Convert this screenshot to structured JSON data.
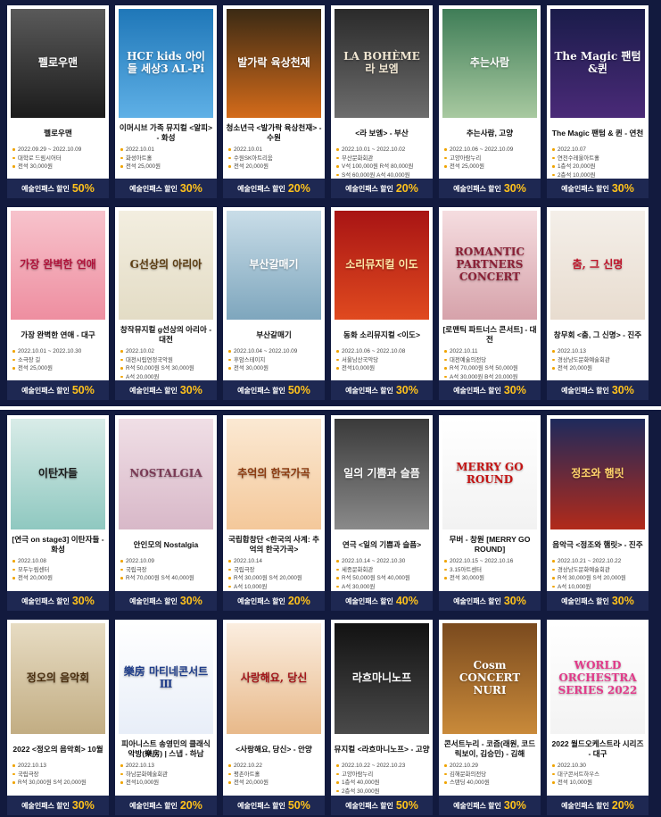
{
  "discount_label": "예술인패스 할인",
  "colors": {
    "section_bg": "#121a3e",
    "discount_bg": "#1e2852",
    "percent": "#ffc21c",
    "bullet": "#f0a400"
  },
  "section1": [
    {
      "poster_text": "펠로우맨",
      "poster_bg": "linear-gradient(180deg,#5a5a5a,#1b1b1b)",
      "poster_color": "#ffffff",
      "title": "펠로우맨",
      "info": [
        "2022.09.29 ~ 2022.10.09",
        "대학로 드림시어터",
        "전석 30,000원"
      ],
      "percent": "50%"
    },
    {
      "poster_text": "HCF kids 아이들 세상3 AL-Pi",
      "poster_bg": "linear-gradient(180deg,#1f77b8,#5fb0e6)",
      "poster_color": "#ffffff",
      "title": "이머시브 가족 뮤지컬 <알피> - 화성",
      "info": [
        "2022.10.01",
        "화성아트홀",
        "전석 25,000원"
      ],
      "percent": "30%"
    },
    {
      "poster_text": "발가락 육상천재",
      "poster_bg": "linear-gradient(180deg,#3b2a14,#d46b1a)",
      "poster_color": "#ffffff",
      "title": "청소년극 <발가락 육상천재> - 수원",
      "info": [
        "2022.10.01",
        "수원SK아트리움",
        "전석 20,000원"
      ],
      "percent": "20%"
    },
    {
      "poster_text": "LA BOHÈME 라 보엠",
      "poster_bg": "linear-gradient(180deg,#2a2a2a,#6d6d6d)",
      "poster_color": "#f0e6d2",
      "title": "<라 보엠> - 부산",
      "info": [
        "2022.10.01 ~ 2022.10.02",
        "부산문화회관",
        "V석 100,000원  R석 80,000원",
        "S석 60,000원  A석 40,000원"
      ],
      "percent": "20%"
    },
    {
      "poster_text": "추는사람",
      "poster_bg": "linear-gradient(180deg,#3f7d57,#a8c9a0)",
      "poster_color": "#ffffff",
      "title": "추는사람, 고양",
      "info": [
        "2022.10.06 ~ 2022.10.09",
        "고양아람누리",
        "전석 25,000원"
      ],
      "percent": "30%"
    },
    {
      "poster_text": "The Magic 팬텀&퀸",
      "poster_bg": "linear-gradient(180deg,#1a1c4a,#4a2a78)",
      "poster_color": "#ffffff",
      "title": "The Magic 팬텀 & 퀸 - 연천",
      "info": [
        "2022.10.07",
        "연천수레울아트홀",
        "1층석 20,000원",
        "2층석 10,000원"
      ],
      "percent": "30%"
    },
    {
      "poster_text": "가장 완벽한 연애",
      "poster_bg": "linear-gradient(180deg,#f7c3cc,#ee8ea0)",
      "poster_color": "#b0123a",
      "title": "가장 완벽한 연애 - 대구",
      "info": [
        "2022.10.01 ~ 2022.10.30",
        "소극장 길",
        "전석 25,000원"
      ],
      "percent": "50%"
    },
    {
      "poster_text": "G선상의 아리아",
      "poster_bg": "linear-gradient(180deg,#f3eee0,#e3dcc5)",
      "poster_color": "#5c3d12",
      "title": "창작뮤지컬 g선상의 아리아 - 대전",
      "info": [
        "2022.10.02",
        "대전시립연정국악원",
        "R석 50,000원  S석 30,000원",
        "A석 20,000원"
      ],
      "percent": "30%"
    },
    {
      "poster_text": "부산갈매기",
      "poster_bg": "linear-gradient(180deg,#c9dde8,#7ea6bd)",
      "poster_color": "#ffffff",
      "title": "부산갈매기",
      "info": [
        "2022.10.04 ~ 2022.10.09",
        "후암스테이지",
        "전석 30,000원"
      ],
      "percent": "50%"
    },
    {
      "poster_text": "소리뮤지컬 이도",
      "poster_bg": "linear-gradient(180deg,#a81414,#e04a1f)",
      "poster_color": "#ffe9a8",
      "title": "동화 소리뮤지컬 <이도>",
      "info": [
        "2022.10.06 ~ 2022.10.08",
        "서울남산국악당",
        "전석10,000원"
      ],
      "percent": "30%"
    },
    {
      "poster_text": "ROMANTIC PARTNERS CONCERT",
      "poster_bg": "linear-gradient(180deg,#f5dde0,#d6a2aa)",
      "poster_color": "#8a1f35",
      "title": "[로맨틱 파트너스 콘서트] - 대전",
      "info": [
        "2022.10.11",
        "대전예술의전당",
        "R석 70,000원  S석 50,000원",
        "A석 30,000원  B석 20,000원"
      ],
      "percent": "30%"
    },
    {
      "poster_text": "춤, 그 신명",
      "poster_bg": "linear-gradient(180deg,#f4efe9,#e8dccf)",
      "poster_color": "#c0142a",
      "title": "창무회 <춤, 그 신명> - 진주",
      "info": [
        "2022.10.13",
        "경상남도문화예술회관",
        "전석 20,000원"
      ],
      "percent": "30%"
    }
  ],
  "section2": [
    {
      "poster_text": "이탄자들",
      "poster_bg": "linear-gradient(180deg,#d9ece8,#8fc8c0)",
      "poster_color": "#1a1a1a",
      "title": "[연극 on stage3] 이탄자들 - 화성",
      "info": [
        "2022.10.08",
        "모두누림센터",
        "전석 20,000원"
      ],
      "percent": "30%"
    },
    {
      "poster_text": "NOSTALGIA",
      "poster_bg": "linear-gradient(180deg,#f0dfe6,#d8b8c8)",
      "poster_color": "#7a3a55",
      "title": "안인모의 Nostalgia",
      "info": [
        "2022.10.09",
        "국립극장",
        "R석 70,000원  S석 40,000원"
      ],
      "percent": "30%"
    },
    {
      "poster_text": "추억의 한국가곡",
      "poster_bg": "linear-gradient(180deg,#fbe9d3,#f4c89a)",
      "poster_color": "#8c3a0f",
      "title": "국립합창단 <한국의 사계: 추억의 한국가곡>",
      "info": [
        "2022.10.14",
        "국립극장",
        "R석 30,000원  S석 20,000원",
        "A석 10,000원"
      ],
      "percent": "20%"
    },
    {
      "poster_text": "일의 기쁨과 슬픔",
      "poster_bg": "linear-gradient(180deg,#3a3a3a,#8a8a8a)",
      "poster_color": "#ffffff",
      "title": "연극 <일의 기쁨과 슬픔>",
      "info": [
        "2022.10.14 ~ 2022.10.30",
        "세종문화회관",
        "R석 50,000원  S석 40,000원",
        "A석 30,000원"
      ],
      "percent": "40%"
    },
    {
      "poster_text": "MERRY GO ROUND",
      "poster_bg": "linear-gradient(180deg,#ffffff,#f2f2f2)",
      "poster_color": "#c41414",
      "title": "무버 - 창원 [MERRY GO ROUND]",
      "info": [
        "2022.10.15 ~ 2022.10.16",
        "3.15아트센터",
        "전석 30,000원"
      ],
      "percent": "30%"
    },
    {
      "poster_text": "정조와 햄릿",
      "poster_bg": "linear-gradient(180deg,#1e2a5c,#b22a1a)",
      "poster_color": "#ffd46a",
      "title": "음악극 <정조와 햄릿> - 진주",
      "info": [
        "2022.10.21 ~ 2022.10.22",
        "경상남도문화예술회관",
        "R석 30,000원  S석 20,000원",
        "A석 10,000원"
      ],
      "percent": "30%"
    },
    {
      "poster_text": "정오의 음악회",
      "poster_bg": "linear-gradient(180deg,#e7dcc3,#c2ad83)",
      "poster_color": "#4a2e0e",
      "title": "2022 <정오의 음악회> 10월",
      "info": [
        "2022.10.13",
        "국립극장",
        "R석 30,000원  S석 20,000원"
      ],
      "percent": "30%"
    },
    {
      "poster_text": "樂房 마티네콘서트Ⅲ",
      "poster_bg": "linear-gradient(180deg,#ffffff,#e8eef8)",
      "poster_color": "#1f3d8a",
      "title": "피아니스트 송영민의 클래식 악방(樂房) | 스냅 - 하남",
      "info": [
        "2022.10.13",
        "하남문화예술회관",
        "전석10,000원"
      ],
      "percent": "20%"
    },
    {
      "poster_text": "사랑해요, 당신",
      "poster_bg": "linear-gradient(180deg,#fbeee0,#e8b98a)",
      "poster_color": "#a4161a",
      "title": "<사랑해요, 당신> - 안양",
      "info": [
        "2022.10.22",
        "평촌아트홀",
        "전석 20,000원"
      ],
      "percent": "50%"
    },
    {
      "poster_text": "라흐마니노프",
      "poster_bg": "linear-gradient(180deg,#121212,#4a4a4a)",
      "poster_color": "#ffffff",
      "title": "뮤지컬 <라흐마니노프> - 고양",
      "info": [
        "2022.10.22 ~ 2022.10.23",
        "고양아람누리",
        "1층석 40,000원",
        "2층석 30,000원"
      ],
      "percent": "50%"
    },
    {
      "poster_text": "Cosm CONCERT NURI",
      "poster_bg": "linear-gradient(180deg,#7a4a1e,#c98a3a)",
      "poster_color": "#ffffff",
      "title": "콘서트누리 - 코즘(래원, 코드릭보이, 김승민) - 김해",
      "info": [
        "2022.10.29",
        "김해문화의전당",
        "스탠딩 40,000원"
      ],
      "percent": "30%"
    },
    {
      "poster_text": "WORLD ORCHESTRA SERIES 2022",
      "poster_bg": "linear-gradient(180deg,#ffffff,#f3f3f3)",
      "poster_color": "#e23a8a",
      "title": "2022 월드오케스트라 시리즈 - 대구",
      "info": [
        "2022.10.30",
        "대구콘서트하우스",
        "전석 10,000원"
      ],
      "percent": "20%"
    }
  ]
}
